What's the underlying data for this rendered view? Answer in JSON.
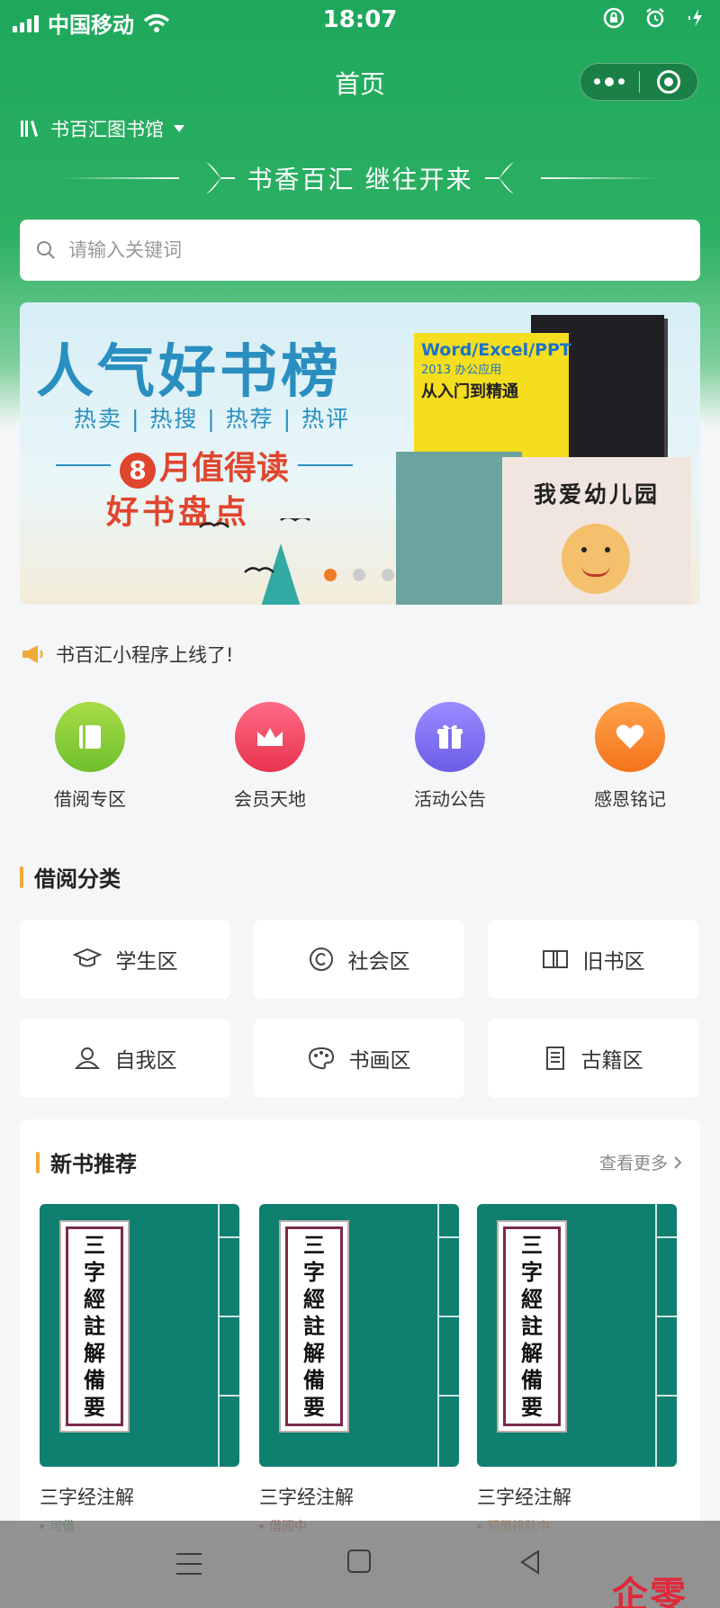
{
  "status_bar": {
    "carrier": "中国移动",
    "time": "18:07",
    "icons": [
      "signal-icon",
      "wifi-icon",
      "orientation-lock-icon",
      "alarm-icon",
      "charging-icon"
    ]
  },
  "nav": {
    "title": "首页",
    "capsule": [
      "more-dots-icon",
      "close-circle-icon"
    ]
  },
  "header": {
    "library_name": "书百汇图书馆",
    "slogan": "书香百汇  继往开来"
  },
  "search": {
    "placeholder": "请输入关键词",
    "value": ""
  },
  "banner": {
    "title": "人气好书榜",
    "tags": "热卖 | 热搜 | 热荐 | 热评",
    "month_num": "8",
    "sub1": "月值得读",
    "sub2": "好书盘点",
    "book1_title": "Word/Excel/PPT",
    "book1_sub": "2013 办公应用",
    "book1_tag": "从入门到精通",
    "book2_title": "我爱幼儿园",
    "pager": {
      "total": 3,
      "active": 0
    },
    "colors": {
      "title": "#2a8fc0",
      "accent": "#e0452d",
      "active_dot": "#f07b26"
    }
  },
  "notice": {
    "icon": "megaphone-icon",
    "text": "书百汇小程序上线了!"
  },
  "quick_entries": [
    {
      "label": "借阅专区",
      "icon": "book-icon",
      "color": "#8ccf3a"
    },
    {
      "label": "会员天地",
      "icon": "crown-icon",
      "color": "#f2456c"
    },
    {
      "label": "活动公告",
      "icon": "gift-icon",
      "color": "#7b6ff0"
    },
    {
      "label": "感恩铭记",
      "icon": "heart-icon",
      "color": "#fb8a2e"
    }
  ],
  "categories": {
    "title": "借阅分类",
    "items": [
      {
        "label": "学生区",
        "icon": "graduation-cap-icon"
      },
      {
        "label": "社会区",
        "icon": "copyright-circle-icon"
      },
      {
        "label": "旧书区",
        "icon": "open-book-icon"
      },
      {
        "label": "自我区",
        "icon": "person-icon"
      },
      {
        "label": "书画区",
        "icon": "palette-icon"
      },
      {
        "label": "古籍区",
        "icon": "document-icon"
      }
    ]
  },
  "new_books": {
    "title": "新书推荐",
    "more": "查看更多",
    "cover_text": [
      "三",
      "字",
      "經",
      "註",
      "解",
      "備",
      "要"
    ],
    "items": [
      {
        "name": "三字经注解",
        "status": "可借",
        "status_color": "#2e8b3d"
      },
      {
        "name": "三字经注解",
        "status": "借阅中",
        "status_color": "#c0392b"
      },
      {
        "name": "三字经注解",
        "status": "预借排队中",
        "status_color": "#e08a1e"
      }
    ]
  },
  "system_nav": [
    "menu-icon",
    "home-icon",
    "back-icon"
  ],
  "watermark": "企零云"
}
